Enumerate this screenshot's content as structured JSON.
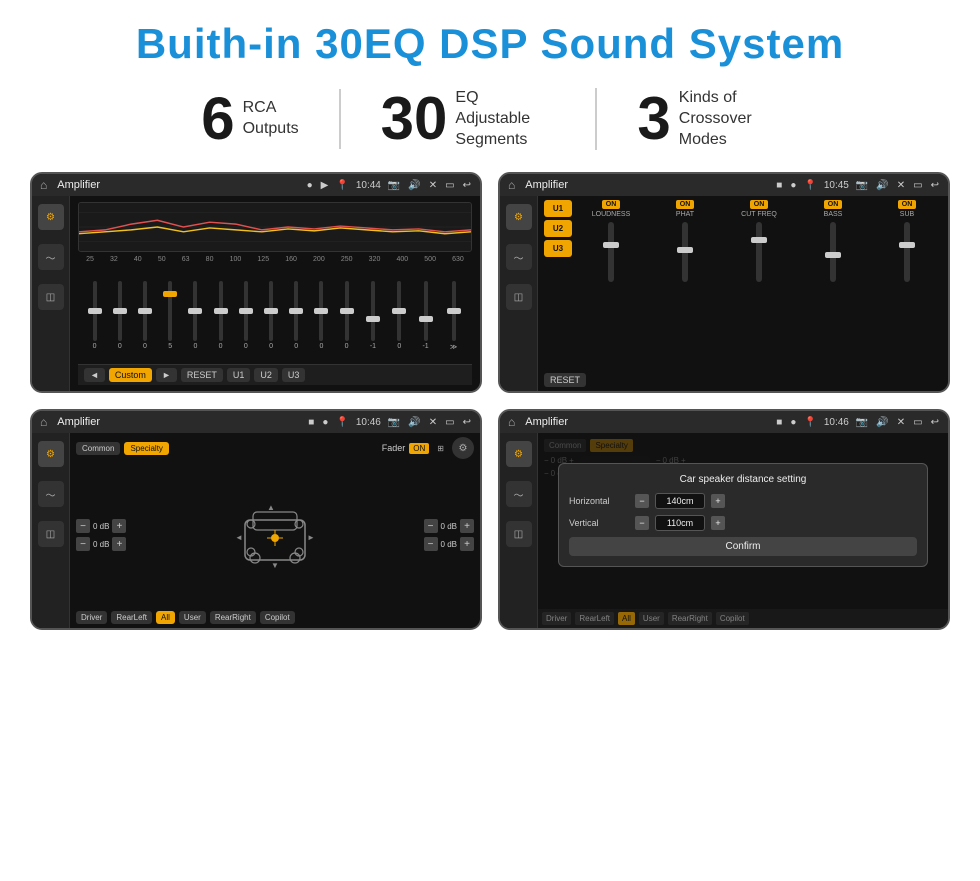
{
  "title": "Buith-in 30EQ DSP Sound System",
  "stats": [
    {
      "number": "6",
      "text": "RCA\nOutputs"
    },
    {
      "number": "30",
      "text": "EQ Adjustable\nSegments"
    },
    {
      "number": "3",
      "text": "Kinds of\nCrossover Modes"
    }
  ],
  "screens": [
    {
      "id": "eq-screen",
      "status_bar": {
        "title": "Amplifier",
        "time": "10:44"
      }
    },
    {
      "id": "crossover-screen",
      "status_bar": {
        "title": "Amplifier",
        "time": "10:45"
      }
    },
    {
      "id": "fader-screen",
      "status_bar": {
        "title": "Amplifier",
        "time": "10:46"
      }
    },
    {
      "id": "dialog-screen",
      "status_bar": {
        "title": "Amplifier",
        "time": "10:46"
      },
      "dialog": {
        "title": "Car speaker distance setting",
        "horizontal_label": "Horizontal",
        "horizontal_value": "140cm",
        "vertical_label": "Vertical",
        "vertical_value": "110cm",
        "confirm_label": "Confirm"
      }
    }
  ],
  "eq": {
    "freq_labels": [
      "25",
      "32",
      "40",
      "50",
      "63",
      "80",
      "100",
      "125",
      "160",
      "200",
      "250",
      "320",
      "400",
      "500",
      "630"
    ],
    "values": [
      "0",
      "0",
      "0",
      "5",
      "0",
      "0",
      "0",
      "0",
      "0",
      "0",
      "0",
      "-1",
      "0",
      "-1"
    ],
    "presets": [
      "◄",
      "Custom",
      "►",
      "RESET",
      "U1",
      "U2",
      "U3"
    ]
  },
  "crossover": {
    "presets": [
      "U1",
      "U2",
      "U3"
    ],
    "channels": [
      "LOUDNESS",
      "PHAT",
      "CUT FREQ",
      "BASS",
      "SUB"
    ],
    "reset_label": "RESET"
  },
  "fader": {
    "modes": [
      "Common",
      "Specialty"
    ],
    "fader_label": "Fader",
    "on_label": "ON",
    "db_values": [
      "0 dB",
      "0 dB",
      "0 dB",
      "0 dB"
    ],
    "position_btns": [
      "Driver",
      "RearLeft",
      "All",
      "User",
      "RearRight",
      "Copilot"
    ]
  }
}
